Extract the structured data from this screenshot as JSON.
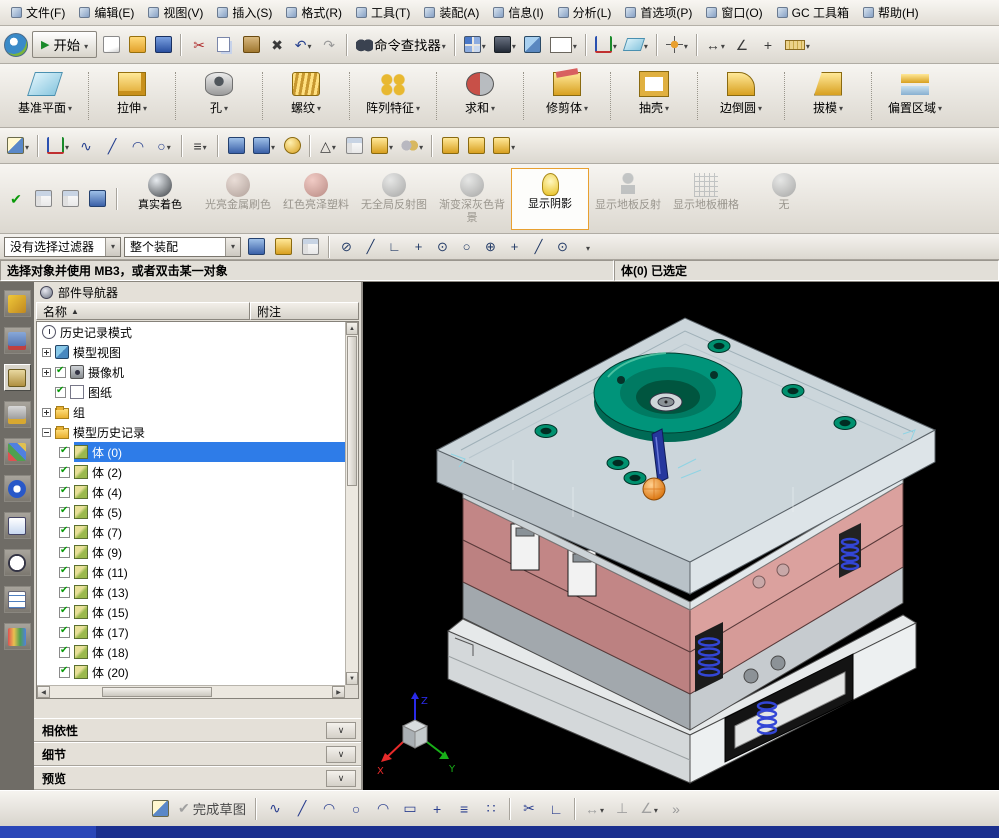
{
  "menubar": {
    "items": [
      {
        "label": "文件(F)"
      },
      {
        "label": "编辑(E)"
      },
      {
        "label": "视图(V)"
      },
      {
        "label": "插入(S)"
      },
      {
        "label": "格式(R)"
      },
      {
        "label": "工具(T)"
      },
      {
        "label": "装配(A)"
      },
      {
        "label": "信息(I)"
      },
      {
        "label": "分析(L)"
      },
      {
        "label": "首选项(P)"
      },
      {
        "label": "窗口(O)"
      },
      {
        "label": "GC 工具箱"
      },
      {
        "label": "帮助(H)"
      }
    ]
  },
  "toolbar_standard": {
    "start_label": "开始",
    "command_finder_label": "命令查找器"
  },
  "toolbar_features": {
    "items": [
      {
        "label": "基准平面"
      },
      {
        "label": "拉伸"
      },
      {
        "label": "孔"
      },
      {
        "label": "螺纹"
      },
      {
        "label": "阵列特征"
      },
      {
        "label": "求和"
      },
      {
        "label": "修剪体"
      },
      {
        "label": "抽壳"
      },
      {
        "label": "边倒圆"
      },
      {
        "label": "拔模"
      },
      {
        "label": "偏置区域"
      }
    ]
  },
  "toolbar_render": {
    "items": [
      {
        "label": "真实着色",
        "state": "enabled"
      },
      {
        "label": "光亮金属刷色",
        "state": "disabled"
      },
      {
        "label": "红色亮泽塑料",
        "state": "disabled"
      },
      {
        "label": "无全局反射图",
        "state": "disabled"
      },
      {
        "label": "渐变深灰色背景",
        "state": "disabled"
      },
      {
        "label": "显示阴影",
        "state": "selected"
      },
      {
        "label": "显示地板反射",
        "state": "disabled"
      },
      {
        "label": "显示地板栅格",
        "state": "disabled"
      },
      {
        "label": "无",
        "state": "disabled"
      }
    ]
  },
  "selection_bar": {
    "filter_value": "没有选择过滤器",
    "scope_value": "整个装配"
  },
  "prompt_bar": {
    "message": "选择对象并使用 MB3，或者双击某一对象",
    "status": "体(0) 已选定"
  },
  "part_navigator": {
    "title": "部件导航器",
    "columns": {
      "name": "名称",
      "sort_indicator": "▲",
      "note": "附注"
    },
    "tree": [
      {
        "label": "历史记录模式"
      },
      {
        "label": "模型视图"
      },
      {
        "label": "摄像机"
      },
      {
        "label": "图纸"
      },
      {
        "label": "组"
      },
      {
        "label": "模型历史记录"
      },
      {
        "label": "体 (0)",
        "selected": true
      },
      {
        "label": "体 (2)"
      },
      {
        "label": "体 (4)"
      },
      {
        "label": "体 (5)"
      },
      {
        "label": "体 (7)"
      },
      {
        "label": "体 (9)"
      },
      {
        "label": "体 (11)"
      },
      {
        "label": "体 (13)"
      },
      {
        "label": "体 (15)"
      },
      {
        "label": "体 (17)"
      },
      {
        "label": "体 (18)"
      },
      {
        "label": "体 (20)"
      }
    ],
    "sections": [
      {
        "label": "相依性"
      },
      {
        "label": "细节"
      },
      {
        "label": "预览"
      }
    ]
  },
  "sketch_bar": {
    "finish_label": "完成草图"
  },
  "viewport": {
    "triad": {
      "x": "X",
      "y": "Y",
      "z": "Z"
    }
  },
  "colors": {
    "viewport_background": "#000000",
    "selection_highlight": "#2e7ce8",
    "mold_plate_salmon": "#c28686",
    "locating_ring_green": "#00947a",
    "spring_blue": "#3346d6",
    "center_of_mass_orange": "#e8831d",
    "status_bar_blue": "#1b2f8e"
  },
  "icons": {
    "start-arrow": "▶",
    "scissors": "✂",
    "delete-x": "✖",
    "undo-arrow": "↶",
    "redo-arrow": "↷",
    "check-mark": "✔",
    "sort-asc": "▲",
    "triangle": "△",
    "spline-wave": "∿",
    "diagonal-line": "╱",
    "arc": "◠",
    "circle": "○",
    "rectangle": "▭",
    "plus": "+",
    "offset-lines": "≡",
    "pattern-dots": "∷",
    "right-angle": "∟",
    "dimension-arrow": "↔",
    "perpendicular": "⊥",
    "angle": "∠",
    "snap-center": "⊙",
    "snap-plus": "⊕",
    "snap-off": "⊘",
    "overflow-chevrons": "»",
    "section-chevron": "∨",
    "scroll-left": "◀",
    "scroll-right": "▶",
    "scroll-up": "▲",
    "scroll-down": "▼"
  }
}
